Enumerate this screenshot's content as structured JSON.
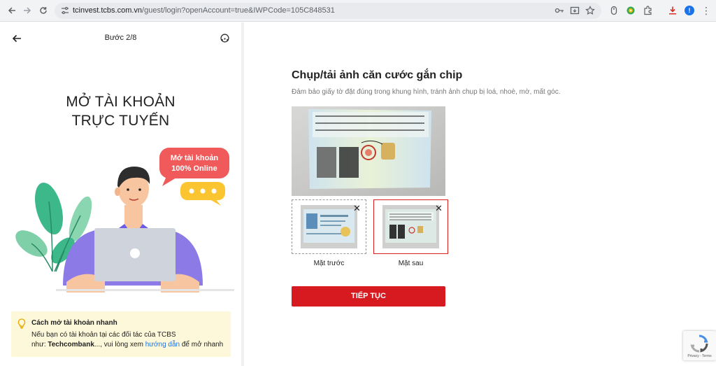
{
  "browser": {
    "url_domain": "tcinvest.tcbs.com.vn",
    "url_path": "/guest/login?openAccount=true&IWPCode=105C848531",
    "profile_initial": "!"
  },
  "left": {
    "step": "Bước 2/8",
    "headline_line1": "MỞ TÀI KHOẢN",
    "headline_line2": "TRỰC TUYẾN",
    "bubble_line1": "Mở tài khoản",
    "bubble_line2": "100% Online",
    "tip_title": "Cách mở tài khoản nhanh",
    "tip_text1": "Nếu bạn có tài khoản tại các đối tác của TCBS",
    "tip_text2_prefix": "như: ",
    "tip_partner": "Techcombank",
    "tip_text2_mid": "..., vui lòng xem ",
    "tip_link": "hướng dẫn",
    "tip_text2_suffix": " để mở nhanh"
  },
  "right": {
    "title": "Chụp/tải ảnh căn cước gắn chip",
    "subtitle": "Đảm bảo giấy tờ đặt đúng trong khung hình, tránh ảnh chụp bị loá, nhoè, mờ, mất góc.",
    "front_label": "Mặt trước",
    "back_label": "Mặt sau",
    "continue_button": "TIẾP TỤC",
    "recaptcha_text": "Privacy - Terms"
  },
  "colors": {
    "brand_red": "#d71920",
    "tip_bg": "#fdf8d9",
    "link_blue": "#1a73e8"
  },
  "icons": [
    "back-arrow-icon",
    "forward-arrow-icon",
    "reload-icon",
    "tune-icon",
    "key-icon",
    "install-icon",
    "star-icon",
    "extension-icon",
    "download-icon",
    "support-icon",
    "lightbulb-icon",
    "close-icon",
    "recaptcha-icon"
  ]
}
